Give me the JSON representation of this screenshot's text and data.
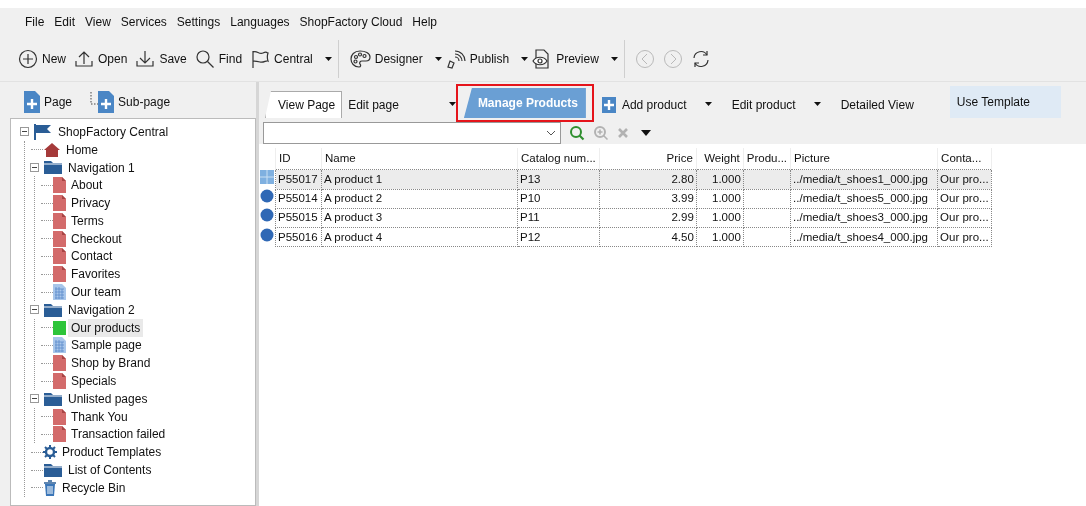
{
  "menu": [
    "File",
    "Edit",
    "View",
    "Services",
    "Settings",
    "Languages",
    "ShopFactory Cloud",
    "Help"
  ],
  "toolbar": [
    {
      "kind": "button",
      "label": "New",
      "dropdown": false,
      "disabled": false
    },
    {
      "kind": "button",
      "label": "Open",
      "dropdown": false,
      "disabled": false
    },
    {
      "kind": "button",
      "label": "Save",
      "dropdown": false,
      "disabled": false
    },
    {
      "kind": "button",
      "label": "Find",
      "dropdown": false,
      "disabled": false
    },
    {
      "kind": "button",
      "label": "Central",
      "dropdown": true,
      "disabled": false
    },
    {
      "kind": "separator"
    },
    {
      "kind": "button",
      "label": "Designer",
      "dropdown": true,
      "disabled": false
    },
    {
      "kind": "button",
      "label": "Publish",
      "dropdown": true,
      "disabled": false
    },
    {
      "kind": "button",
      "label": "Preview",
      "dropdown": true,
      "disabled": false
    },
    {
      "kind": "separator"
    },
    {
      "kind": "button",
      "disabled": true
    },
    {
      "kind": "button",
      "disabled": true
    },
    {
      "kind": "button",
      "disabled": false
    }
  ],
  "sidebar": {
    "buttons": [
      "Page",
      "Sub-page"
    ],
    "tree": [
      {
        "kind": "root",
        "label": "ShopFactory Central",
        "selected": false,
        "expanded": true,
        "children": [
          {
            "kind": "home",
            "label": "Home",
            "selected": false
          },
          {
            "kind": "folder",
            "label": "Navigation 1",
            "selected": false,
            "expanded": true,
            "children": [
              {
                "kind": "page",
                "label": "About",
                "selected": false
              },
              {
                "kind": "page",
                "label": "Privacy",
                "selected": false
              },
              {
                "kind": "page",
                "label": "Terms",
                "selected": false
              },
              {
                "kind": "page",
                "label": "Checkout",
                "selected": false
              },
              {
                "kind": "page",
                "label": "Contact",
                "selected": false
              },
              {
                "kind": "page",
                "label": "Favorites",
                "selected": false
              },
              {
                "kind": "layout",
                "label": "Our team",
                "selected": false
              }
            ]
          },
          {
            "kind": "folder",
            "label": "Navigation 2",
            "selected": false,
            "expanded": true,
            "children": [
              {
                "kind": "products",
                "label": "Our products",
                "selected": true
              },
              {
                "kind": "layout",
                "label": "Sample page",
                "selected": false
              },
              {
                "kind": "page",
                "label": "Shop by Brand",
                "selected": false
              },
              {
                "kind": "page",
                "label": "Specials",
                "selected": false
              }
            ]
          },
          {
            "kind": "folder",
            "label": "Unlisted pages",
            "selected": false,
            "expanded": true,
            "children": [
              {
                "kind": "page",
                "label": "Thank You",
                "selected": false
              },
              {
                "kind": "page",
                "label": "Transaction failed",
                "selected": false
              }
            ]
          },
          {
            "kind": "settings",
            "label": "Product Templates",
            "selected": false
          },
          {
            "kind": "folder",
            "label": "List of Contents",
            "selected": false
          },
          {
            "kind": "bin",
            "label": "Recycle Bin",
            "selected": false
          }
        ]
      }
    ]
  },
  "tabs": [
    {
      "kind": "framed",
      "label": "View Page",
      "selected": false,
      "dropdown": false
    },
    {
      "kind": "plain",
      "label": "Edit page",
      "selected": false,
      "dropdown": true
    },
    {
      "kind": "plain",
      "label": "Manage Products",
      "selected": true,
      "dropdown": false,
      "highlighted": true
    },
    {
      "kind": "button",
      "label": "Add product",
      "dropdown": true
    },
    {
      "kind": "button",
      "label": "Edit product",
      "dropdown": true
    },
    {
      "kind": "button",
      "label": "Detailed View",
      "dropdown": false
    },
    {
      "kind": "toggle",
      "label": "Use Template",
      "on": true
    }
  ],
  "search": {
    "tools": [
      {
        "disabled": false
      },
      {
        "disabled": true
      },
      {
        "disabled": true
      },
      {
        "disabled": false
      }
    ]
  },
  "table": {
    "columns": [
      {
        "kind": "text",
        "label": "ID"
      },
      {
        "kind": "text",
        "label": "Name"
      },
      {
        "kind": "text",
        "label": "Catalog num..."
      },
      {
        "kind": "number",
        "label": "Price"
      },
      {
        "kind": "number",
        "label": "Weight"
      },
      {
        "kind": "text",
        "label": "Produ..."
      },
      {
        "kind": "text",
        "label": "Picture"
      },
      {
        "kind": "text",
        "label": "Conta..."
      }
    ],
    "rows": [
      {
        "kind": "template",
        "selected": true,
        "cells": [
          "P55017",
          "A product 1",
          "P13",
          "2.80",
          "1.000",
          "",
          "../media/t_shoes1_000.jpg",
          "Our pro..."
        ]
      },
      {
        "kind": "product",
        "selected": false,
        "cells": [
          "P55014",
          "A product 2",
          "P10",
          "3.99",
          "1.000",
          "",
          "../media/t_shoes5_000.jpg",
          "Our pro..."
        ]
      },
      {
        "kind": "product",
        "selected": false,
        "cells": [
          "P55015",
          "A product 3",
          "P11",
          "2.99",
          "1.000",
          "",
          "../media/t_shoes3_000.jpg",
          "Our pro..."
        ]
      },
      {
        "kind": "product",
        "selected": false,
        "cells": [
          "P55016",
          "A product 4",
          "P12",
          "4.50",
          "1.000",
          "",
          "../media/t_shoes4_000.jpg",
          "Our pro..."
        ]
      }
    ]
  }
}
